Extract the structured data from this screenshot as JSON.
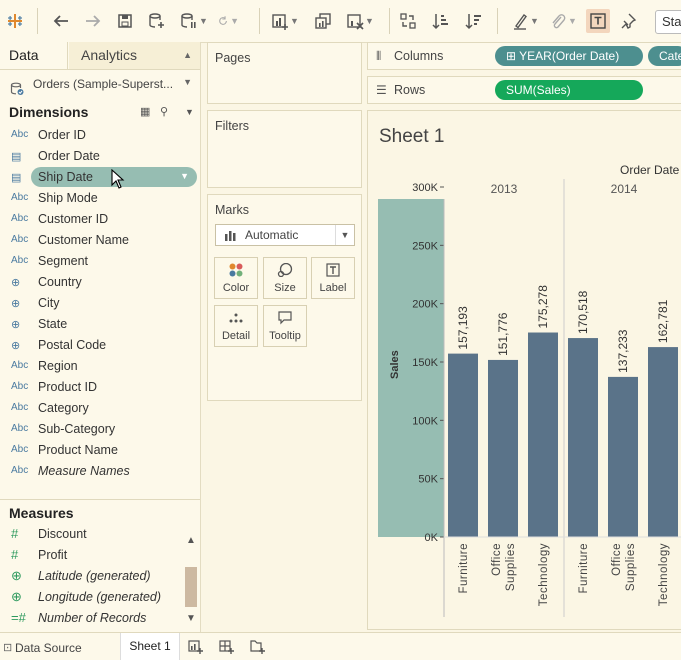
{
  "toolbar": {
    "standard_label": "Sta"
  },
  "left_pane": {
    "tabs": [
      {
        "label": "Data"
      },
      {
        "label": "Analytics"
      }
    ],
    "datasource": "Orders (Sample-Superst...",
    "dimensions_title": "Dimensions",
    "dimensions": [
      {
        "type": "Abc",
        "icon": "abc",
        "name": "Order ID"
      },
      {
        "type": "",
        "icon": "calendar-icon",
        "name": "Order Date"
      },
      {
        "type": "",
        "icon": "calendar-icon",
        "name": "Ship Date",
        "selected": true
      },
      {
        "type": "Abc",
        "icon": "abc",
        "name": "Ship Mode"
      },
      {
        "type": "Abc",
        "icon": "abc",
        "name": "Customer ID"
      },
      {
        "type": "Abc",
        "icon": "abc",
        "name": "Customer Name"
      },
      {
        "type": "Abc",
        "icon": "abc",
        "name": "Segment"
      },
      {
        "type": "",
        "icon": "globe-icon",
        "name": "Country"
      },
      {
        "type": "",
        "icon": "globe-icon",
        "name": "City"
      },
      {
        "type": "",
        "icon": "globe-icon",
        "name": "State"
      },
      {
        "type": "",
        "icon": "globe-icon",
        "name": "Postal Code"
      },
      {
        "type": "Abc",
        "icon": "abc",
        "name": "Region"
      },
      {
        "type": "Abc",
        "icon": "abc",
        "name": "Product ID"
      },
      {
        "type": "Abc",
        "icon": "abc",
        "name": "Category"
      },
      {
        "type": "Abc",
        "icon": "abc",
        "name": "Sub-Category"
      },
      {
        "type": "Abc",
        "icon": "abc",
        "name": "Product Name"
      },
      {
        "type": "Abc",
        "icon": "abc",
        "name": "Measure Names",
        "italic": true
      }
    ],
    "measures_title": "Measures",
    "measures": [
      {
        "icon": "hash-icon",
        "name": "Discount"
      },
      {
        "icon": "hash-icon",
        "name": "Profit"
      },
      {
        "icon": "globe-icon",
        "name": "Latitude (generated)",
        "italic": true
      },
      {
        "icon": "globe-icon",
        "name": "Longitude (generated)",
        "italic": true
      },
      {
        "icon": "hash-icon",
        "name": "Number of Records",
        "italic": true
      }
    ]
  },
  "cards": {
    "pages": "Pages",
    "filters": "Filters",
    "marks": "Marks",
    "marks_type": "Automatic",
    "mark_buttons": [
      "Color",
      "Size",
      "Label",
      "Detail",
      "Tooltip"
    ]
  },
  "shelves": {
    "columns_label": "Columns",
    "rows_label": "Rows",
    "columns_pills": [
      "YEAR(Order Date)",
      "Cate"
    ],
    "rows_pills": [
      "SUM(Sales)"
    ]
  },
  "viz": {
    "sheet_title": "Sheet 1",
    "column_header": "Order Date"
  },
  "chart_data": {
    "type": "bar",
    "ylabel": "Sales",
    "column_header": "Order Date",
    "y_ticks": [
      "0K",
      "50K",
      "100K",
      "150K",
      "200K",
      "250K",
      "300K"
    ],
    "ylim": [
      0,
      300000
    ],
    "groups": [
      {
        "year": "2013",
        "bars": [
          {
            "category": "Furniture",
            "value": 157193,
            "label": "157,193"
          },
          {
            "category": "Office Supplies",
            "value": 151776,
            "label": "151,776"
          },
          {
            "category": "Technology",
            "value": 175278,
            "label": "175,278"
          }
        ]
      },
      {
        "year": "2014",
        "bars": [
          {
            "category": "Furniture",
            "value": 170518,
            "label": "170,518"
          },
          {
            "category": "Office Supplies",
            "value": 137233,
            "label": "137,233"
          },
          {
            "category": "Technology",
            "value": 162781,
            "label": "162,781"
          }
        ]
      }
    ],
    "bar_color": "#5a7389",
    "axis_highlight_color": "#96bdb2"
  },
  "statusbar": {
    "datasource_tab": "Data Source",
    "sheet_tab": "Sheet 1"
  }
}
